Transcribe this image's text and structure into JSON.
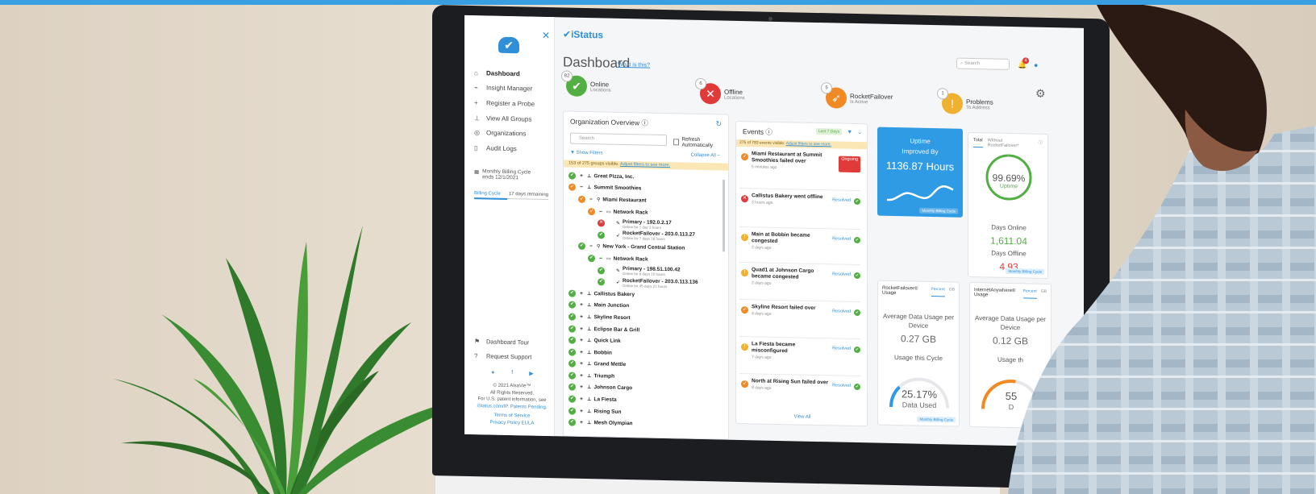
{
  "app": {
    "brand": "iStatus",
    "page_title": "Dashboard",
    "what_is_this": "What is this?",
    "search_placeholder": "Search",
    "notification_count": "4"
  },
  "sidebar": {
    "items": [
      {
        "label": "Dashboard",
        "icon": "home-icon"
      },
      {
        "label": "Insight Manager",
        "icon": "chart-icon"
      },
      {
        "label": "Register a Probe",
        "icon": "plus-icon"
      },
      {
        "label": "View All Groups",
        "icon": "sitemap-icon"
      },
      {
        "label": "Organizations",
        "icon": "globe-icon"
      },
      {
        "label": "Audit Logs",
        "icon": "clipboard-icon"
      }
    ],
    "billing_title": "Monthly Billing Cycle",
    "billing_ends": "ends 12/1/2021",
    "billing_cycle_label": "Billing Cycle",
    "billing_remaining": "17 days remaining",
    "billing_progress": 0.45,
    "tour": "Dashboard Tour",
    "support": "Request Support",
    "copyright": "© 2021 AlsaVie™",
    "rights": "All Rights Reserved.",
    "patent": "For U.S. patent information, see",
    "patent_link": "iStatus.com/IP. Patents Pending.",
    "terms": "Terms of Service",
    "privacy": "Privacy Policy",
    "eula": "EULA"
  },
  "stats": [
    {
      "count": "82",
      "label": "Online",
      "sub": "Locations",
      "color": "#52b043",
      "icon": "check-icon"
    },
    {
      "count": "6",
      "label": "Offline",
      "sub": "Locations",
      "color": "#e03a3a",
      "icon": "x-icon"
    },
    {
      "count": "5",
      "label": "RocketFailover",
      "sub": "Is Active",
      "color": "#f08a24",
      "icon": "rocket-icon"
    },
    {
      "count": "1",
      "label": "Problems",
      "sub": "To Address",
      "color": "#f0b030",
      "icon": "exclamation-icon"
    }
  ],
  "org": {
    "title": "Organization Overview",
    "search_placeholder": "Search",
    "refresh_auto": "Refresh Automatically",
    "show_filters": "Show Filters",
    "collapse_all": "Collapse All",
    "visible_notice": "153 of 275 groups visible.",
    "adjust_filters": "Adjust filters to see more.",
    "tree": [
      {
        "label": "Great Pizza, Inc.",
        "status": "g",
        "indent": 0,
        "sign": "+",
        "icon": "sitemap-icon"
      },
      {
        "label": "Summit Smoothies",
        "status": "o",
        "indent": 0,
        "sign": "−",
        "icon": "sitemap-icon"
      },
      {
        "label": "Miami Restaurant",
        "status": "o",
        "indent": 1,
        "sign": "−",
        "icon": "pin-icon"
      },
      {
        "label": "Network Rack",
        "status": "o",
        "indent": 2,
        "sign": "−",
        "icon": "router-icon"
      },
      {
        "label": "Primary - 192.0.2.17",
        "sub": "Online for 1 day 3 hours",
        "status": "r",
        "indent": 3,
        "sign": "",
        "icon": "probe-icon"
      },
      {
        "label": "RocketFailover - 203.0.113.27",
        "sub": "Online for 7 days 18 hours",
        "status": "g",
        "indent": 3,
        "sign": "",
        "icon": "rocket-icon"
      },
      {
        "label": "New York - Grand Central Station",
        "status": "g",
        "indent": 1,
        "sign": "−",
        "icon": "pin-icon"
      },
      {
        "label": "Network Rack",
        "status": "g",
        "indent": 2,
        "sign": "−",
        "icon": "router-icon"
      },
      {
        "label": "Primary - 198.51.100.42",
        "sub": "Online for 8 days 10 hours",
        "status": "g",
        "indent": 3,
        "sign": "",
        "icon": "probe-icon"
      },
      {
        "label": "RocketFailover - 203.0.113.136",
        "sub": "Online for 45 days 21 hours",
        "status": "g",
        "indent": 3,
        "sign": "",
        "icon": "rocket-icon"
      },
      {
        "label": "Callistus Bakery",
        "status": "g",
        "indent": 0,
        "sign": "+",
        "icon": "sitemap-icon"
      },
      {
        "label": "Main Junction",
        "status": "g",
        "indent": 0,
        "sign": "+",
        "icon": "sitemap-icon"
      },
      {
        "label": "Skyline Resort",
        "status": "g",
        "indent": 0,
        "sign": "+",
        "icon": "sitemap-icon"
      },
      {
        "label": "Eclipse Bar & Grill",
        "status": "g",
        "indent": 0,
        "sign": "+",
        "icon": "sitemap-icon"
      },
      {
        "label": "Quick Link",
        "status": "g",
        "indent": 0,
        "sign": "+",
        "icon": "sitemap-icon"
      },
      {
        "label": "Bobbin",
        "status": "g",
        "indent": 0,
        "sign": "+",
        "icon": "sitemap-icon"
      },
      {
        "label": "Grand Mettle",
        "status": "g",
        "indent": 0,
        "sign": "+",
        "icon": "sitemap-icon"
      },
      {
        "label": "Triumph",
        "status": "g",
        "indent": 0,
        "sign": "+",
        "icon": "sitemap-icon"
      },
      {
        "label": "Johnson Cargo",
        "status": "g",
        "indent": 0,
        "sign": "+",
        "icon": "sitemap-icon"
      },
      {
        "label": "La Fiesta",
        "status": "g",
        "indent": 0,
        "sign": "+",
        "icon": "sitemap-icon"
      },
      {
        "label": "Rising Sun",
        "status": "g",
        "indent": 0,
        "sign": "+",
        "icon": "sitemap-icon"
      },
      {
        "label": "Mesh Olympian",
        "status": "g",
        "indent": 0,
        "sign": "+",
        "icon": "sitemap-icon"
      }
    ]
  },
  "events": {
    "title": "Events",
    "range": "Last 7 Days",
    "visible_notice": "275 of 783 events visible.",
    "adjust_filters": "Adjust filters to see more.",
    "view_all": "View All",
    "items": [
      {
        "title": "Miami Restaurant at Summit Smoothies failed over",
        "ago": "5 minutes ago",
        "status": "Ongoing",
        "color": "o",
        "icon": "rocket-icon"
      },
      {
        "title": "Callistus Bakery went offline",
        "ago": "3 hours ago",
        "status": "Resolved",
        "color": "r",
        "icon": "x-icon"
      },
      {
        "title": "Main at Bobbin became congested",
        "ago": "2 days ago",
        "status": "Resolved",
        "color": "y",
        "icon": "congested-icon"
      },
      {
        "title": "Quad1 at Johnson Cargo became congested",
        "ago": "2 days ago",
        "status": "Resolved",
        "color": "y",
        "icon": "congested-icon"
      },
      {
        "title": "Skyline Resort failed over",
        "ago": "4 days ago",
        "status": "Resolved",
        "color": "o",
        "icon": "rocket-icon"
      },
      {
        "title": "La Fiesta became misconfigured",
        "ago": "7 days ago",
        "status": "Resolved",
        "color": "y",
        "icon": "exclamation-icon"
      },
      {
        "title": "North at Rising Sun failed over",
        "ago": "8 days ago",
        "status": "Resolved",
        "color": "o",
        "icon": "rocket-icon"
      }
    ]
  },
  "uptime": {
    "line1": "Uptime",
    "line2": "Improved By",
    "value": "1136.87 Hours",
    "tag": "Monthly Billing Cycle"
  },
  "total": {
    "tab_total": "Total",
    "tab_without": "Without RocketFailover*",
    "pct": "99.69%",
    "pct_sub": "Uptime",
    "pct_value": 0.9969,
    "days_online_label": "Days Online",
    "days_online": "1,611.04",
    "days_offline_label": "Days Offline",
    "days_offline": "4.93",
    "tag": "Monthly Billing Cycle"
  },
  "usage": [
    {
      "title": "RocketFailover® Usage",
      "tab1": "Percent",
      "tab2": "GB",
      "avg_label": "Average Data Usage per Device",
      "avg": "0.27 GB",
      "cycle_label": "Usage this Cycle",
      "pct": "25.17%",
      "pct_value": 0.2517,
      "pct_sub": "Data Used",
      "gauge_color": "#2f9be5",
      "tag": "Monthly Billing Cycle"
    },
    {
      "title": "InternetAnywhere® Usage",
      "tab1": "Percent",
      "tab2": "GB",
      "avg_label": "Average Data Usage per Device",
      "avg": "0.12 GB",
      "cycle_label": "Usage th",
      "pct": "55",
      "pct_value": 0.55,
      "pct_sub": "D",
      "gauge_color": "#f08a24",
      "tag": ""
    }
  ]
}
